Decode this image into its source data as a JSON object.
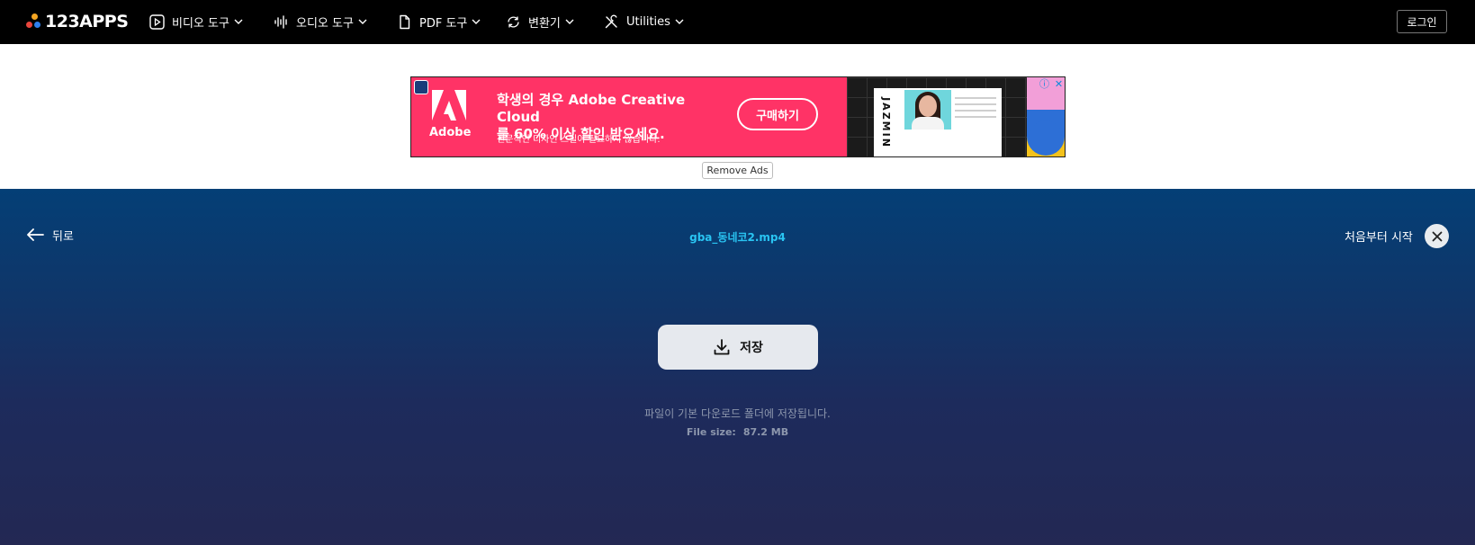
{
  "header": {
    "logo_text": "123APPS",
    "logo_colors": [
      "#f5a623",
      "#e8453c",
      "#2f80ed"
    ],
    "nav": [
      {
        "label": "비디오 도구",
        "icon": "play-icon"
      },
      {
        "label": "오디오 도구",
        "icon": "waveform-icon"
      },
      {
        "label": "PDF 도구",
        "icon": "document-icon"
      },
      {
        "label": "변환기",
        "icon": "convert-icon"
      },
      {
        "label": "Utilities",
        "icon": "tools-icon"
      }
    ],
    "login_label": "로그인"
  },
  "ad": {
    "brand": "Adobe",
    "headline_line1": "학생의 경우 Adobe Creative Cloud",
    "headline_line2": "를 60% 이상 할인 받으세요.",
    "sub": "전문적인 디자인 스킬이 필요하지 않습니다.",
    "cta": "구매하기",
    "side_text": "JAZMIN",
    "remove_ads": "Remove Ads",
    "bg_color": "#ff3366"
  },
  "main": {
    "back_label": "뒤로",
    "filename": "gba_동네코2.mp4",
    "restart_label": "처음부터 시작",
    "save_label": "저장",
    "save_note": "파일이 기본 다운로드 폴더에 저장됩니다.",
    "file_size_label": "File size:",
    "file_size_value": "87.2 MB"
  }
}
